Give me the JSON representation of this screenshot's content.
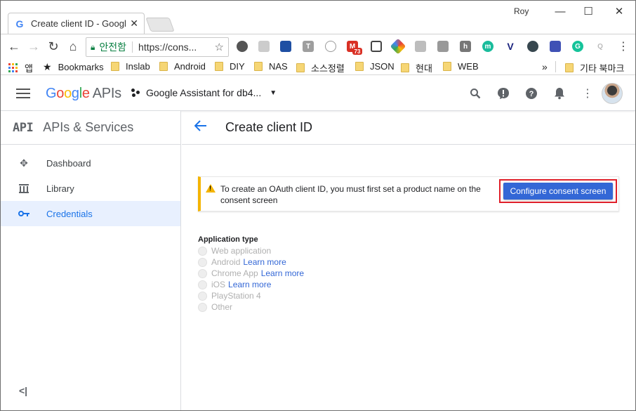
{
  "browser": {
    "tab_title": "Create client ID - Google",
    "profile_name": "Roy",
    "omnibox": {
      "secure_label": "안전함",
      "url": "https://cons..."
    },
    "extension_badge": "73",
    "bookmarks": {
      "apps_label": "앱",
      "items": [
        "Bookmarks",
        "Inslab",
        "Android",
        "DIY",
        "NAS",
        "소스정렬",
        "JSON",
        "현대",
        "WEB"
      ],
      "overflow": "»",
      "other": "기타 북마크"
    }
  },
  "console": {
    "logo_google": "Google",
    "logo_apis": "APIs",
    "project_name": "Google Assistant for db4..."
  },
  "sidebar": {
    "api_logo": "API",
    "title": "APIs & Services",
    "items": [
      {
        "label": "Dashboard",
        "icon": "dashboard-icon",
        "active": false
      },
      {
        "label": "Library",
        "icon": "library-icon",
        "active": false
      },
      {
        "label": "Credentials",
        "icon": "key-icon",
        "active": true
      }
    ],
    "collapse": "<|"
  },
  "main": {
    "title": "Create client ID",
    "notice": {
      "message": "To create an OAuth client ID, you must first set a product name on the consent screen",
      "button_label": "Configure consent screen"
    },
    "application_type": {
      "label": "Application type",
      "options": [
        {
          "label": "Web application",
          "learn_more": ""
        },
        {
          "label": "Android",
          "learn_more": "Learn more"
        },
        {
          "label": "Chrome App",
          "learn_more": "Learn more"
        },
        {
          "label": "iOS",
          "learn_more": "Learn more"
        },
        {
          "label": "PlayStation 4",
          "learn_more": ""
        },
        {
          "label": "Other",
          "learn_more": ""
        }
      ]
    }
  },
  "colors": {
    "accent": "#1a73e8",
    "button": "#3367d6",
    "warning": "#f4b400",
    "highlight_border": "#e0202a"
  }
}
